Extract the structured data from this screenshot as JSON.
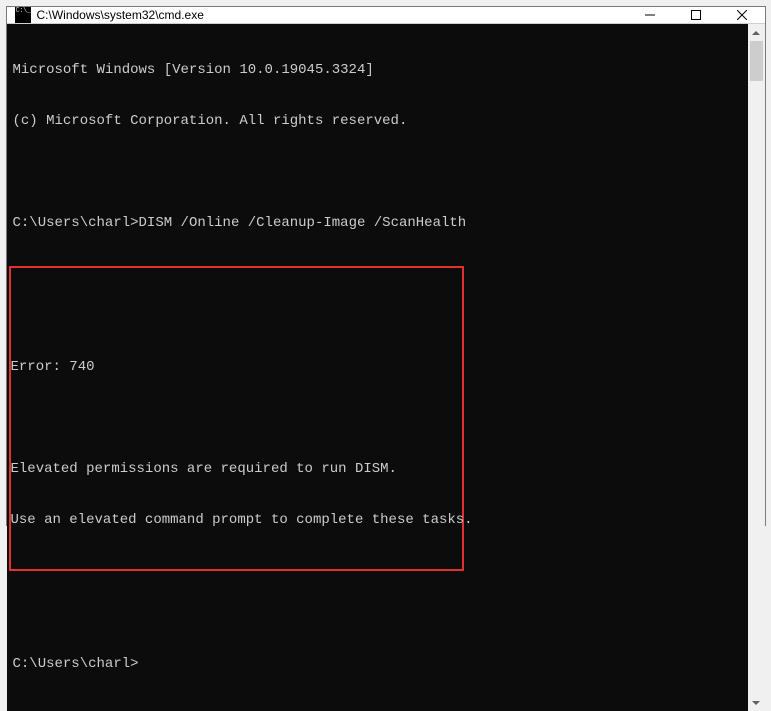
{
  "window": {
    "title": "C:\\Windows\\system32\\cmd.exe"
  },
  "terminal": {
    "header_line1": "Microsoft Windows [Version 10.0.19045.3324]",
    "header_line2": "(c) Microsoft Corporation. All rights reserved.",
    "prompt1": "C:\\Users\\charl>",
    "command1": "DISM /Online /Cleanup-Image /ScanHealth",
    "error_line": "Error: 740",
    "error_msg1": "Elevated permissions are required to run DISM.",
    "error_msg2": "Use an elevated command prompt to complete these tasks.",
    "prompt2": "C:\\Users\\charl>"
  },
  "highlight_color": "#e03030"
}
